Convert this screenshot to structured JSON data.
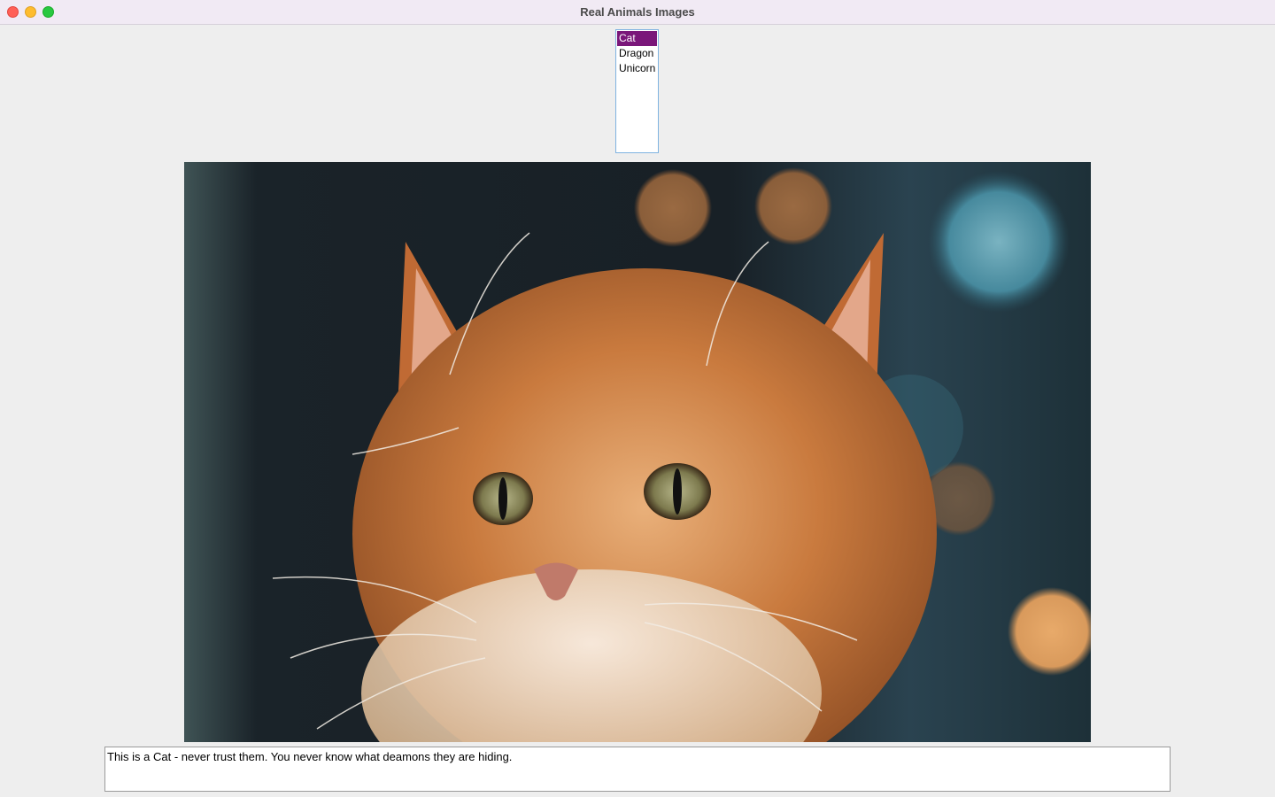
{
  "window": {
    "title": "Real Animals Images"
  },
  "animal_list": {
    "items": [
      {
        "label": "Cat",
        "selected": true
      },
      {
        "label": "Dragon",
        "selected": false
      },
      {
        "label": "Unicorn",
        "selected": false
      }
    ],
    "selection_color": "#7a177a"
  },
  "image": {
    "subject": "cat"
  },
  "description": {
    "text": "This is a Cat - never trust them. You never know what deamons they are hiding."
  }
}
